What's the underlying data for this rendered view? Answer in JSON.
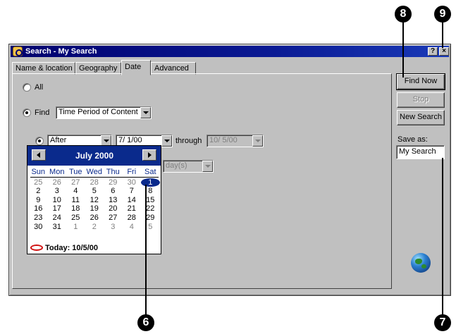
{
  "window": {
    "title": "Search - My Search",
    "help_button": "?",
    "close_button": "×"
  },
  "tabs": [
    "Name & location",
    "Geography",
    "Date",
    "Advanced"
  ],
  "active_tab": "Date",
  "date_panel": {
    "all_label": "All",
    "find_label": "Find",
    "find_type": "Time Period of Content",
    "relation": "After",
    "start_date": "7/ 1/00",
    "through_label": "through",
    "end_date": "10/ 5/00",
    "unit": "day(s)"
  },
  "buttons": {
    "find_now": "Find Now",
    "stop": "Stop",
    "new_search": "New Search"
  },
  "save_as": {
    "label": "Save as:",
    "value": "My Search"
  },
  "calendar": {
    "month_title": "July 2000",
    "days_of_week": [
      "Sun",
      "Mon",
      "Tue",
      "Wed",
      "Thu",
      "Fri",
      "Sat"
    ],
    "weeks": [
      [
        "25",
        "26",
        "27",
        "28",
        "29",
        "30",
        "1"
      ],
      [
        "2",
        "3",
        "4",
        "5",
        "6",
        "7",
        "8"
      ],
      [
        "9",
        "10",
        "11",
        "12",
        "13",
        "14",
        "15"
      ],
      [
        "16",
        "17",
        "18",
        "19",
        "20",
        "21",
        "22"
      ],
      [
        "23",
        "24",
        "25",
        "26",
        "27",
        "28",
        "29"
      ],
      [
        "30",
        "31",
        "1",
        "2",
        "3",
        "4",
        "5"
      ]
    ],
    "selected_day": "1",
    "today_label": "Today: 10/5/00"
  },
  "callouts": [
    "6",
    "7",
    "8",
    "9"
  ],
  "colors": {
    "title_bar": "#0a1a94",
    "calendar_header": "#0a2a8c",
    "today_ring": "#d01010",
    "window_face": "#c0c0c0"
  }
}
